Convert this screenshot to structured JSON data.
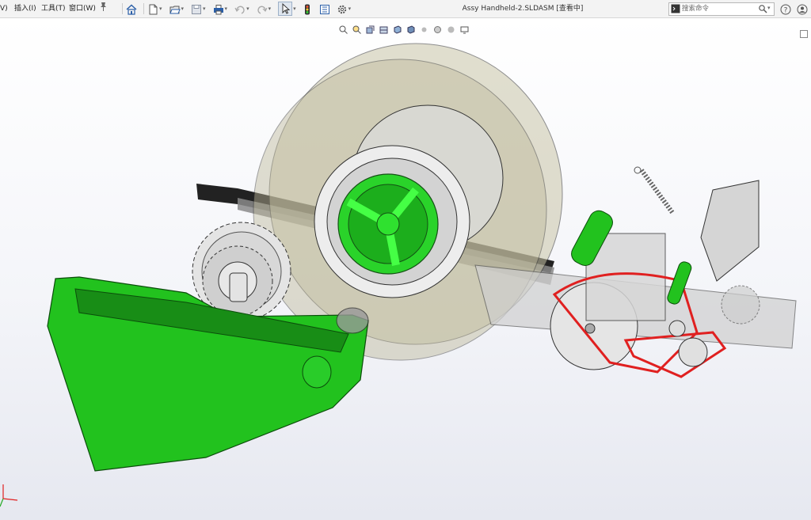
{
  "menu": {
    "item0": "V)",
    "insert": "插入(I)",
    "tools": "工具(T)",
    "window": "窗口(W)"
  },
  "window": {
    "title": "Assy Handheld-2.SLDASM [查看中]"
  },
  "search": {
    "placeholder": "搜索命令"
  },
  "colors": {
    "part_green": "#22c21e",
    "belt_red": "#e02020",
    "rack_dark": "#222222",
    "gear_grey": "#d0d0d0",
    "roll_transparent": "#bdb89a"
  },
  "icons": [
    "home-icon",
    "new-document-icon",
    "open-file-icon",
    "save-icon",
    "print-icon",
    "undo-icon",
    "redo-icon",
    "select-pointer-icon",
    "traffic-light-icon",
    "file-properties-icon",
    "options-gear-icon",
    "search-icon",
    "help-icon",
    "user-icon"
  ]
}
